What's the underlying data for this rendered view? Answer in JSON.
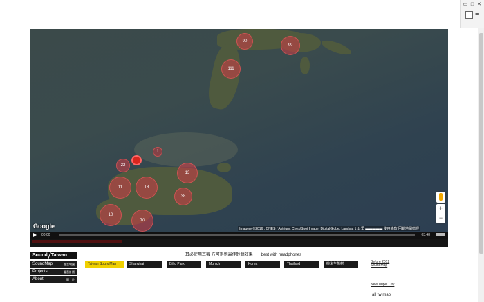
{
  "window": {
    "controls": [
      "▭",
      "□",
      "✕"
    ]
  },
  "map": {
    "markers": [
      "90",
      "99",
      "111",
      "1",
      "22",
      "13",
      "11",
      "18",
      "38",
      "10",
      "70",
      "11"
    ],
    "logo": "Google",
    "attribution": "Imagery ©2016 , CNES / Astrium, Cnes/Spot Image, DigitalGlobe, Landsat  1 公里 ▬▬▬▬▬  使用條款  回報地圖錯誤",
    "zoom_in": "+",
    "zoom_out": "−"
  },
  "player": {
    "current_time": "00:00",
    "duration": "03:48"
  },
  "notice": {
    "zh": "耳必使用耳機 方可得到最佳聆聽效果",
    "en": "best with headphones"
  },
  "nav": {
    "brand_left": "Sound",
    "brand_right": "Taiwan",
    "items": [
      {
        "en": "SoundMap",
        "zh": "聲音地圖"
      },
      {
        "en": "Projects",
        "zh": "聲音計劃"
      },
      {
        "en": "About",
        "zh": "關　於"
      }
    ]
  },
  "tabs": [
    "Taiwan SoundMap",
    "Shanghai",
    "Bihu Park",
    "Munich",
    "Korea",
    "Thailand",
    "桃米生態村"
  ],
  "links": {
    "before": "Before 2012 SoundMap",
    "new_taipei": "New Taipei City",
    "all_tw": "all tw map"
  },
  "colors": {
    "marker": "#d23c46",
    "active_tab": "#f0d000",
    "nav_bg": "#111111"
  }
}
